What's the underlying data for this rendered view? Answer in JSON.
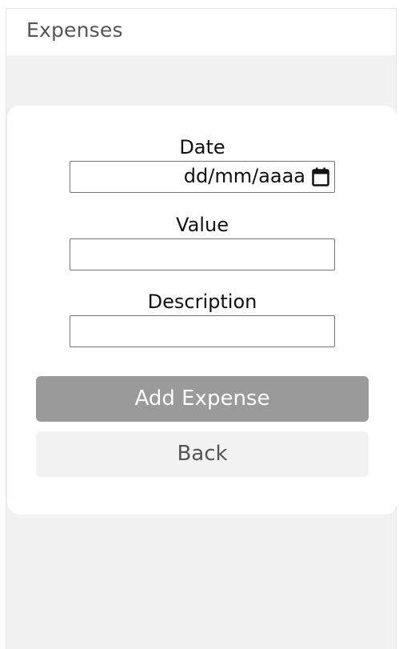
{
  "header": {
    "title": "Expenses"
  },
  "form": {
    "date": {
      "label": "Date",
      "placeholder": "dd/mm/aaaa",
      "icon": "calendar-icon"
    },
    "value": {
      "label": "Value",
      "placeholder": ""
    },
    "description": {
      "label": "Description",
      "placeholder": ""
    },
    "add_button_label": "Add Expense",
    "back_button_label": "Back"
  },
  "colors": {
    "add_button_bg": "#9a9a9a",
    "back_button_bg": "#f2f2f2",
    "page_bg": "#f1f1f1"
  }
}
